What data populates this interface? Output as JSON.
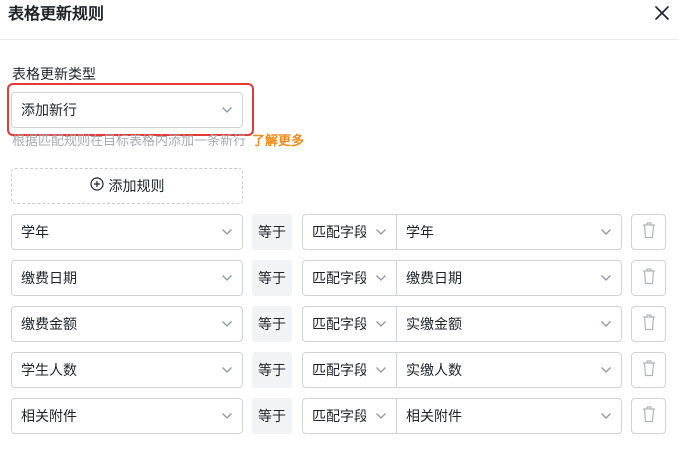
{
  "dialog": {
    "title": "表格更新规则",
    "close_icon": "close-icon"
  },
  "update_type": {
    "label": "表格更新类型",
    "selected": "添加新行",
    "hint": "根据匹配规则在目标表格内添加一条新行",
    "learn_more": "了解更多"
  },
  "add_rule": {
    "label": "添加规则",
    "icon": "plus-circle-icon"
  },
  "rules": [
    {
      "field": "学年",
      "operator": "等于",
      "match_type": "匹配字段",
      "target": "学年"
    },
    {
      "field": "缴费日期",
      "operator": "等于",
      "match_type": "匹配字段",
      "target": "缴费日期"
    },
    {
      "field": "缴费金额",
      "operator": "等于",
      "match_type": "匹配字段",
      "target": "实缴金额"
    },
    {
      "field": "学生人数",
      "operator": "等于",
      "match_type": "匹配字段",
      "target": "实缴人数"
    },
    {
      "field": "相关附件",
      "operator": "等于",
      "match_type": "匹配字段",
      "target": "相关附件"
    }
  ],
  "colors": {
    "highlight": "#e53935",
    "link": "#f08c1c",
    "hint": "#a8abb2",
    "border": "#d0d3d6"
  }
}
